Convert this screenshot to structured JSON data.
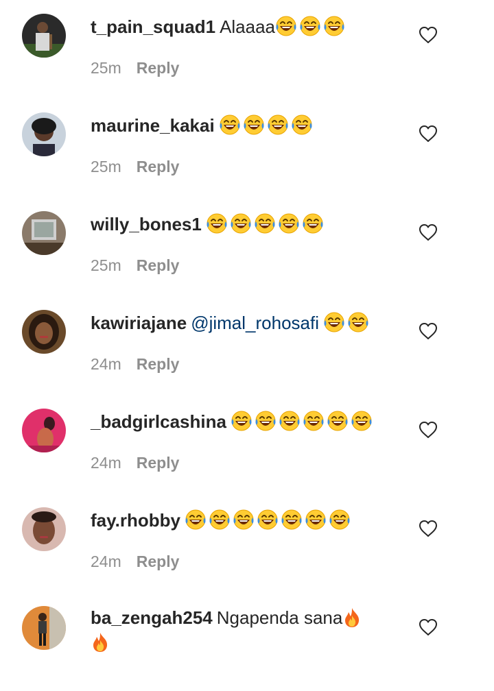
{
  "comments": [
    {
      "username": "t_pain_squad1",
      "text": "Alaaaa",
      "time": "25m",
      "reply": "Reply",
      "emoji_count": 3
    },
    {
      "username": "maurine_kakai",
      "text": "",
      "time": "25m",
      "reply": "Reply",
      "emoji_count": 4
    },
    {
      "username": "willy_bones1",
      "text": "",
      "time": "25m",
      "reply": "Reply",
      "emoji_count": 5
    },
    {
      "username": "kawiriajane",
      "text": "",
      "mention": "@jimal_rohosafi",
      "time": "24m",
      "reply": "Reply",
      "emoji_count": 2
    },
    {
      "username": "_badgirlcashina",
      "text": "",
      "time": "24m",
      "reply": "Reply",
      "emoji_count": 6
    },
    {
      "username": "fay.rhobby",
      "text": "",
      "time": "24m",
      "reply": "Reply",
      "emoji_count": 7
    },
    {
      "username": "ba_zengah254",
      "text": "Ngapenda sana",
      "time": "",
      "reply": "",
      "emoji_count": 0
    }
  ],
  "icons": {
    "laugh_emoji": "face-with-tears-of-joy-icon",
    "fire_emoji": "fire-icon",
    "like": "heart-outline-icon"
  },
  "colors": {
    "username": "#262626",
    "meta": "#8e8e8e",
    "mention": "#00376b"
  }
}
